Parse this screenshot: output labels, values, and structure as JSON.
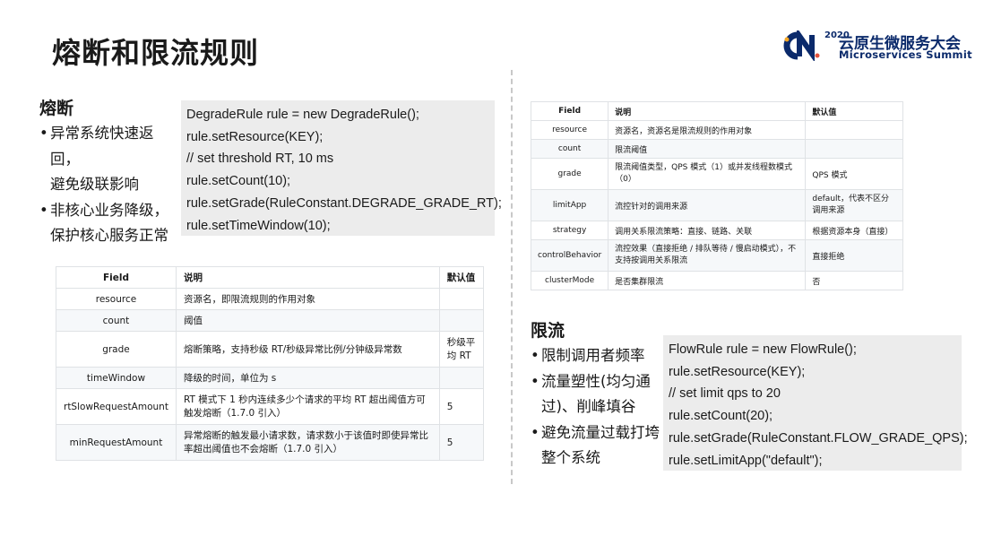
{
  "title": "熔断和限流规则",
  "logo": {
    "year": "2020",
    "cn_title": "云原生微服务大会",
    "en_title": "Microservices Summit"
  },
  "degrade": {
    "heading": "熔断",
    "bullets": [
      [
        "异常系统快速返回，",
        "避免级联影响"
      ],
      [
        "非核心业务降级，",
        "保护核心服务正常"
      ]
    ],
    "code_lines": [
      "DegradeRule  rule = new DegradeRule();",
      "rule.setResource(KEY);",
      "// set threshold RT, 10 ms",
      "rule.setCount(10);",
      "rule.setGrade(RuleConstant.DEGRADE_GRADE_RT);",
      "rule.setTimeWindow(10);"
    ],
    "table": {
      "headers": [
        "Field",
        "说明",
        "默认值"
      ],
      "rows": [
        [
          "resource",
          "资源名，即限流规则的作用对象",
          ""
        ],
        [
          "count",
          "阈值",
          ""
        ],
        [
          "grade",
          "熔断策略，支持秒级 RT/秒级异常比例/分钟级异常数",
          "秒级平均 RT"
        ],
        [
          "timeWindow",
          "降级的时间，单位为 s",
          ""
        ],
        [
          "rtSlowRequestAmount",
          "RT 模式下 1 秒内连续多少个请求的平均 RT 超出阈值方可触发熔断（1.7.0 引入）",
          "5"
        ],
        [
          "minRequestAmount",
          "异常熔断的触发最小请求数，请求数小于该值时即使异常比率超出阈值也不会熔断（1.7.0 引入）",
          "5"
        ]
      ]
    }
  },
  "flow": {
    "heading": "限流",
    "bullets": [
      [
        "限制调用者频率"
      ],
      [
        "流量塑性(均匀通",
        "过)、削峰填谷"
      ],
      [
        "避免流量过载打垮",
        "整个系统"
      ]
    ],
    "code_lines": [
      "FlowRule rule = new FlowRule();",
      "rule.setResource(KEY);",
      "// set limit qps to 20",
      "rule.setCount(20);",
      "rule.setGrade(RuleConstant.FLOW_GRADE_QPS);",
      "rule.setLimitApp(\"default\");"
    ],
    "table": {
      "headers": [
        "Field",
        "说明",
        "默认值"
      ],
      "rows": [
        [
          "resource",
          "资源名，资源名是限流规则的作用对象",
          ""
        ],
        [
          "count",
          "限流阈值",
          ""
        ],
        [
          "grade",
          "限流阈值类型，QPS 模式（1）或并发线程数模式（0）",
          "QPS 模式"
        ],
        [
          "limitApp",
          "流控针对的调用来源",
          "default，代表不区分调用来源"
        ],
        [
          "strategy",
          "调用关系限流策略：直接、链路、关联",
          "根据资源本身（直接）"
        ],
        [
          "controlBehavior",
          "流控效果（直接拒绝 / 排队等待 / 慢启动模式），不支持按调用关系限流",
          "直接拒绝"
        ],
        [
          "clusterMode",
          "是否集群限流",
          "否"
        ]
      ]
    }
  }
}
